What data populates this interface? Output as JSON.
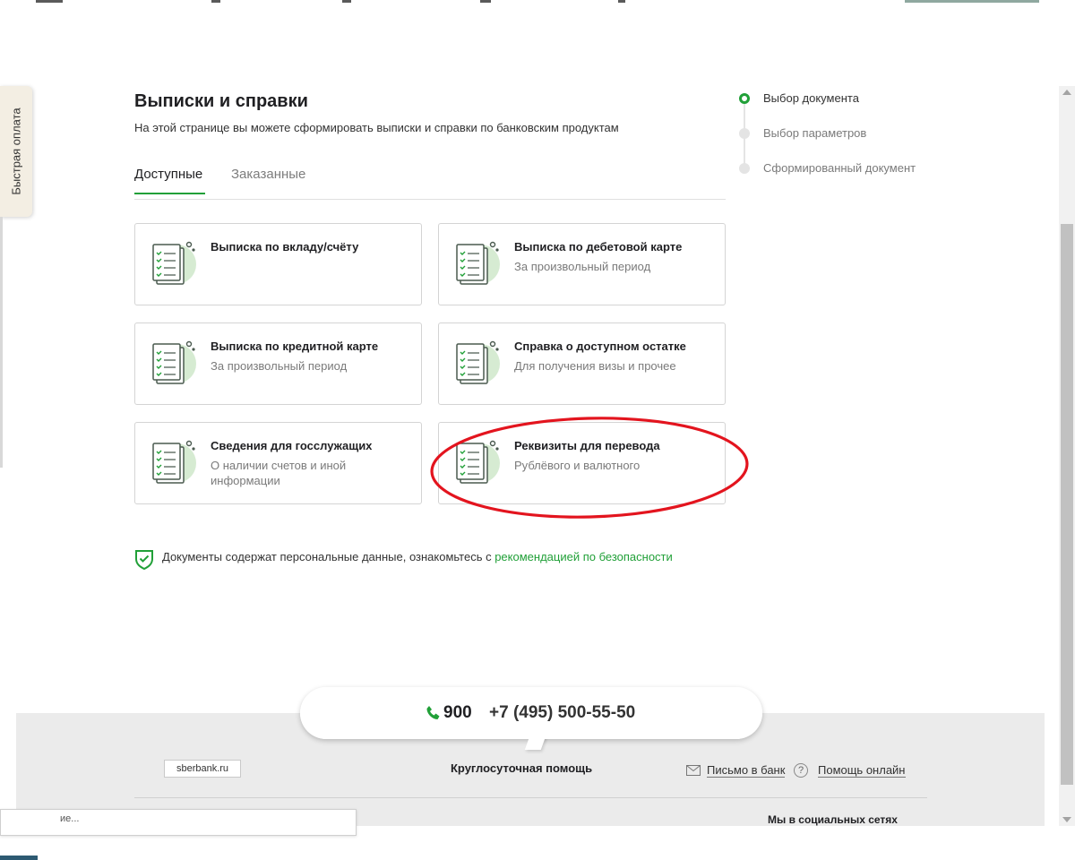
{
  "quick_pay": {
    "label": "Быстрая оплата"
  },
  "header": {
    "title": "Выписки и справки",
    "subtitle": "На этой странице вы можете сформировать выписки и справки по банковским продуктам"
  },
  "tabs": [
    {
      "label": "Доступные",
      "active": true
    },
    {
      "label": "Заказанные",
      "active": false
    }
  ],
  "cards": [
    {
      "title": "Выписка по вкладу/счёту",
      "subtitle": ""
    },
    {
      "title": "Выписка по дебетовой карте",
      "subtitle": "За произвольный период"
    },
    {
      "title": "Выписка по кредитной карте",
      "subtitle": "За произвольный период"
    },
    {
      "title": "Справка о доступном остатке",
      "subtitle": "Для получения визы и прочее"
    },
    {
      "title": "Сведения для госслужащих",
      "subtitle": "О наличии счетов и иной информации"
    },
    {
      "title": "Реквизиты для перевода",
      "subtitle": "Рублёвого и валютного"
    }
  ],
  "security": {
    "text": "Документы содержат персональные данные, ознакомьтесь с ",
    "link": "рекомендацией по безопасности"
  },
  "stepper": [
    {
      "label": "Выбор документа",
      "active": true
    },
    {
      "label": "Выбор параметров",
      "active": false
    },
    {
      "label": "Сформированный документ",
      "active": false
    }
  ],
  "footer": {
    "phone_short": "900",
    "phone_long": "+7 (495) 500-55-50",
    "site_button": "sberbank.ru",
    "support": "Круглосуточная помощь",
    "mail_link": "Письмо в банк",
    "help_link": "Помощь онлайн",
    "help_icon_glyph": "?",
    "social": "Мы в социальных сетях"
  },
  "tooltip": {
    "text": "ие..."
  },
  "colors": {
    "accent": "#21a038",
    "annotation": "#e3141e",
    "footer_bg": "#ebebeb"
  },
  "annotation": {
    "target": "Реквизиты для перевода"
  }
}
